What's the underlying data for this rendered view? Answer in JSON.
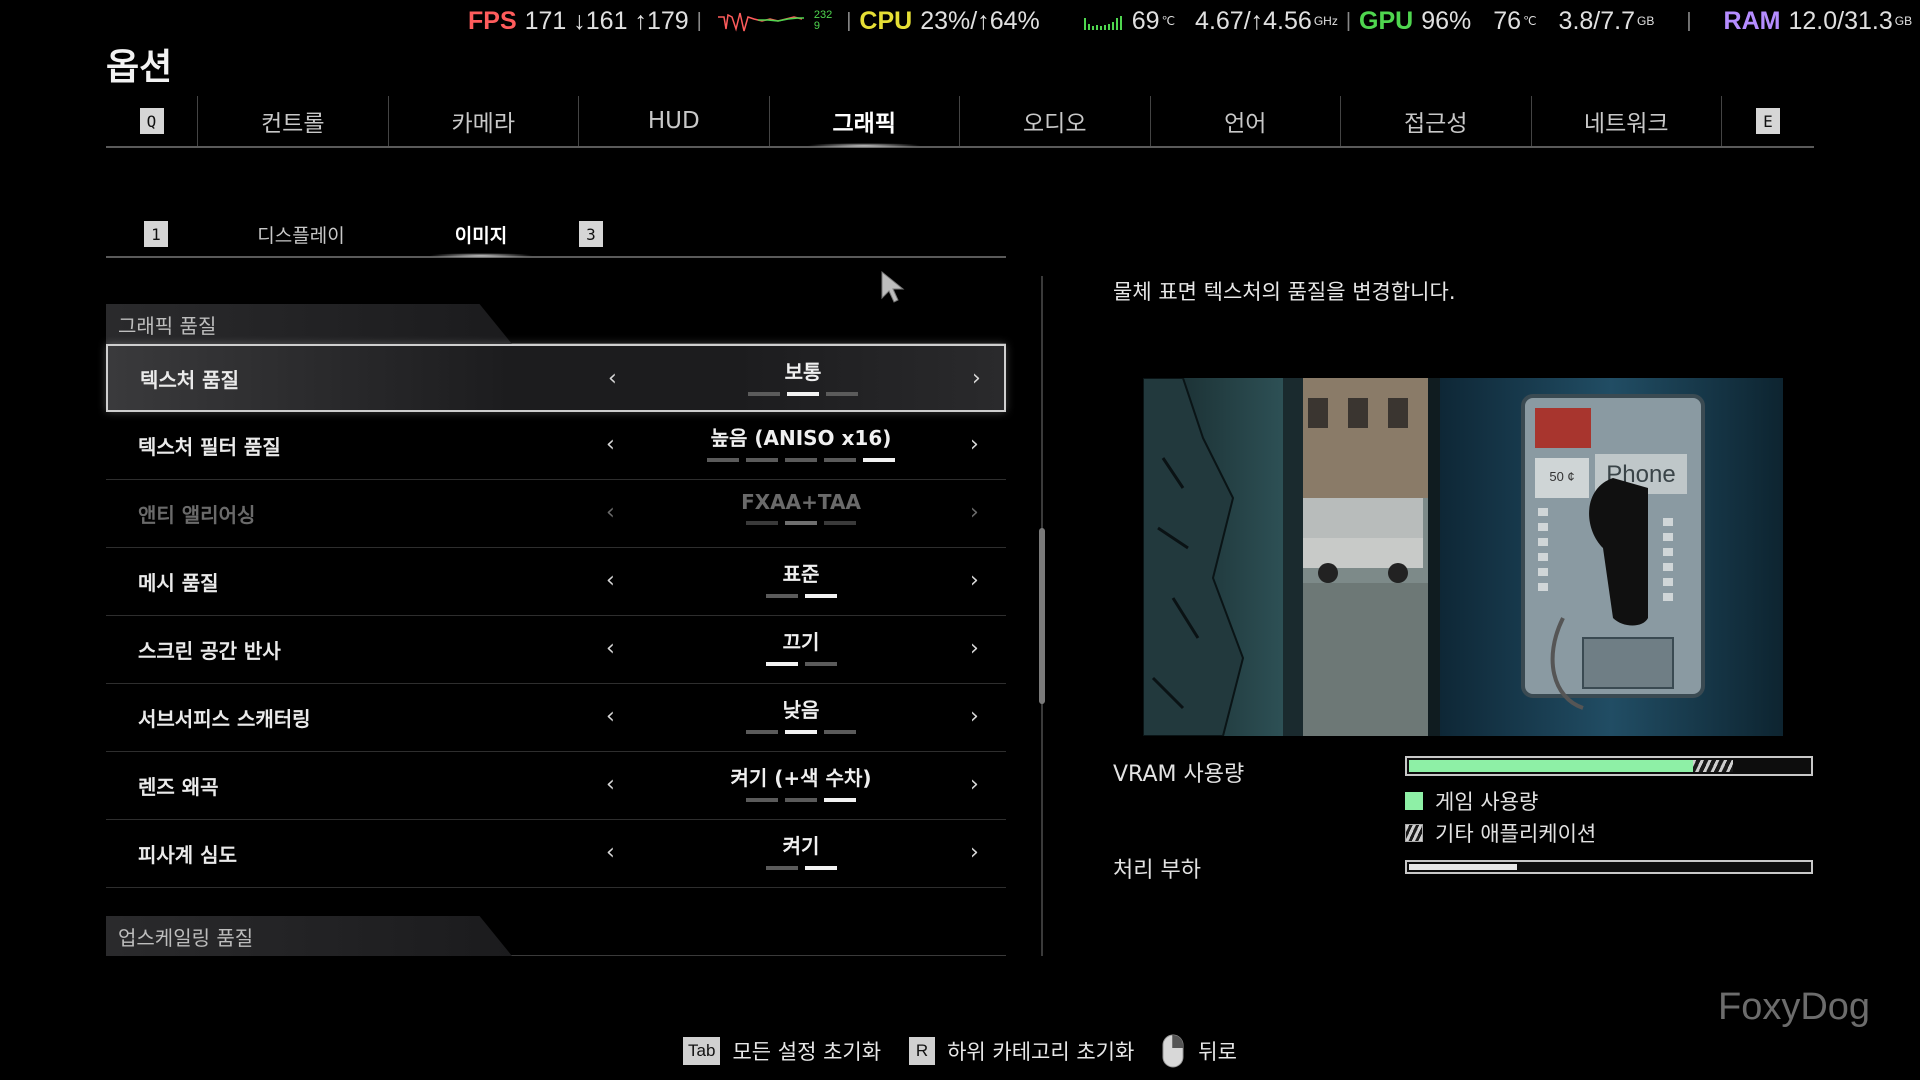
{
  "perf": {
    "fps_label": "FPS",
    "fps_values": "171 ↓161 ↑179",
    "fps_graph_top": "232",
    "fps_graph_bottom": "9",
    "cpu_label": "CPU",
    "cpu_values": "23%/↑64%",
    "cpu_temp": "69",
    "temp_unit": "℃",
    "cpu_clock": "4.67/↑4.56",
    "ghz_unit": "GHz",
    "gpu_label": "GPU",
    "gpu_values": "96%",
    "gpu_temp": "76",
    "gpu_mem": "3.8/7.7",
    "gb_unit": "GB",
    "ram_label": "RAM",
    "ram_values": "12.0/31.3"
  },
  "page": {
    "title": "옵션"
  },
  "main_tabs": {
    "left_key": "Q",
    "right_key": "E",
    "items": [
      {
        "label": "컨트롤"
      },
      {
        "label": "카메라"
      },
      {
        "label": "HUD"
      },
      {
        "label": "그래픽"
      },
      {
        "label": "오디오"
      },
      {
        "label": "언어"
      },
      {
        "label": "접근성"
      },
      {
        "label": "네트워크"
      }
    ],
    "active_index": 3
  },
  "sub_tabs": {
    "left_key": "1",
    "right_key": "3",
    "items": [
      {
        "label": "디스플레이"
      },
      {
        "label": "이미지"
      }
    ],
    "active_index": 1
  },
  "sections": {
    "graphics_quality": "그래픽 품질",
    "upscaling_quality": "업스케일링 품질"
  },
  "settings": [
    {
      "label": "텍스처 품질",
      "value": "보통",
      "levels": 3,
      "current": 2,
      "selected": true
    },
    {
      "label": "텍스처 필터 품질",
      "value": "높음 (ANISO x16)",
      "levels": 5,
      "current": 5
    },
    {
      "label": "앤티 앨리어싱",
      "value": "FXAA+TAA",
      "levels": 3,
      "current": 2,
      "disabled": true
    },
    {
      "label": "메시 품질",
      "value": "표준",
      "levels": 2,
      "current": 2
    },
    {
      "label": "스크린 공간 반사",
      "value": "끄기",
      "levels": 2,
      "current": 1
    },
    {
      "label": "서브서피스 스캐터링",
      "value": "낮음",
      "levels": 3,
      "current": 2
    },
    {
      "label": "렌즈 왜곡",
      "value": "켜기 (+색 수차)",
      "levels": 3,
      "current": 3
    },
    {
      "label": "피사계 심도",
      "value": "켜기",
      "levels": 2,
      "current": 2
    }
  ],
  "description": {
    "text": "물체 표면 텍스처의 품질을 변경합니다.",
    "preview_sign": "Phone",
    "preview_small": "50 ¢"
  },
  "meters": {
    "vram_label": "VRAM 사용량",
    "vram_game_fraction": 0.71,
    "vram_other_fraction": 0.1,
    "legend_game": "게임 사용량",
    "legend_other": "기타 애플리케이션",
    "load_label": "처리 부하",
    "load_fraction": 0.27
  },
  "colors": {
    "game_usage": "#8ef0a6",
    "fps": "#ff5c5c",
    "cpu": "#e6df35",
    "gpu": "#4fd64f",
    "ram": "#b58cff"
  },
  "watermark": "FoxyDog",
  "hints": {
    "reset_all_key": "Tab",
    "reset_all_label": "모든 설정 초기화",
    "reset_sub_key": "R",
    "reset_sub_label": "하위 카테고리 초기화",
    "back_label": "뒤로"
  }
}
